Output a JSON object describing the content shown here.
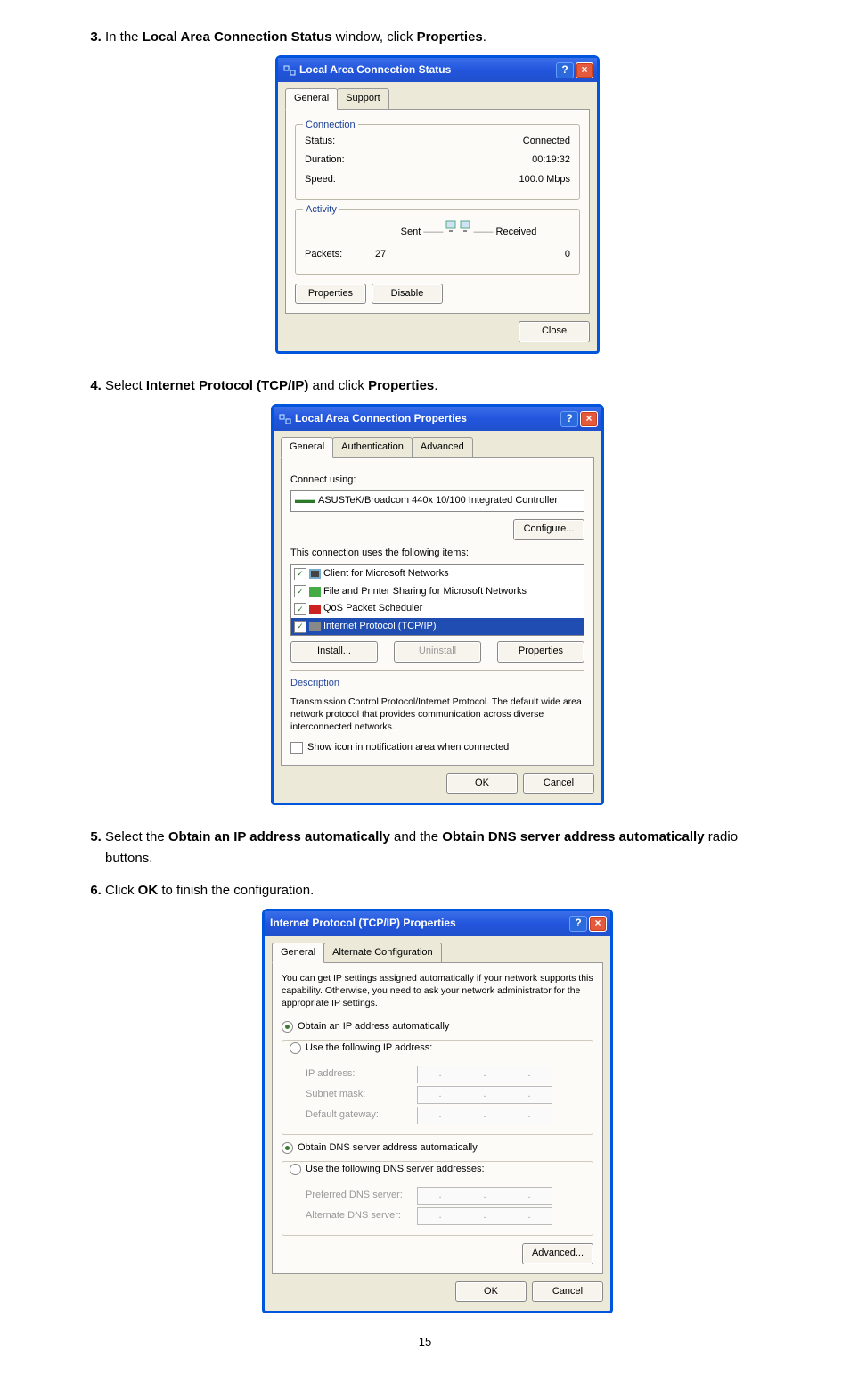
{
  "steps": {
    "s3": {
      "num": "3.",
      "pre": "In the ",
      "b1": "Local Area Connection Status",
      "mid": " window, click ",
      "b2": "Properties",
      "post": "."
    },
    "s4": {
      "num": "4.",
      "pre": "Select ",
      "b1": "Internet Protocol (TCP/IP)",
      "mid": " and click ",
      "b2": "Properties",
      "post": "."
    },
    "s5": {
      "num": "5.",
      "pre": "Select the ",
      "b1": "Obtain an IP address automatically",
      "mid": " and the ",
      "b2": "Obtain DNS server address automatically",
      "post": " radio buttons."
    },
    "s6": {
      "num": "6.",
      "pre": "Click ",
      "b1": "OK",
      "post": " to finish the configuration."
    }
  },
  "d1": {
    "title": "Local Area Connection Status",
    "help": "?",
    "close": "×",
    "tab1": "General",
    "tab2": "Support",
    "grp_conn": "Connection",
    "status_l": "Status:",
    "status_v": "Connected",
    "dur_l": "Duration:",
    "dur_v": "00:19:32",
    "speed_l": "Speed:",
    "speed_v": "100.0 Mbps",
    "grp_act": "Activity",
    "sent": "Sent",
    "recv": "Received",
    "dash": "——",
    "pkt_l": "Packets:",
    "pkt_sent": "27",
    "pkt_recv": "0",
    "props": "Properties",
    "disable": "Disable",
    "close_btn": "Close"
  },
  "d2": {
    "title": "Local Area Connection Properties",
    "help": "?",
    "close": "×",
    "tab1": "General",
    "tab2": "Authentication",
    "tab3": "Advanced",
    "conn_using": "Connect using:",
    "adapter": "ASUSTeK/Broadcom 440x 10/100 Integrated Controller",
    "configure": "Configure...",
    "uses": "This connection uses the following items:",
    "i1": "Client for Microsoft Networks",
    "i2": "File and Printer Sharing for Microsoft Networks",
    "i3": "QoS Packet Scheduler",
    "i4": "Internet Protocol (TCP/IP)",
    "install": "Install...",
    "uninstall": "Uninstall",
    "props": "Properties",
    "desc_h": "Description",
    "desc": "Transmission Control Protocol/Internet Protocol. The default wide area network protocol that provides communication across diverse interconnected networks.",
    "showicon": "Show icon in notification area when connected",
    "ok": "OK",
    "cancel": "Cancel"
  },
  "d3": {
    "title": "Internet Protocol (TCP/IP) Properties",
    "help": "?",
    "close": "×",
    "tab1": "General",
    "tab2": "Alternate Configuration",
    "intro": "You can get IP settings assigned automatically if your network supports this capability. Otherwise, you need to ask your network administrator for the appropriate IP settings.",
    "r1": "Obtain an IP address automatically",
    "r2": "Use the following IP address:",
    "ip": "IP address:",
    "mask": "Subnet mask:",
    "gw": "Default gateway:",
    "r3": "Obtain DNS server address automatically",
    "r4": "Use the following DNS server addresses:",
    "pdns": "Preferred DNS server:",
    "adns": "Alternate DNS server:",
    "adv": "Advanced...",
    "ok": "OK",
    "cancel": "Cancel",
    "dots": ". . ."
  },
  "pagenum": "15"
}
